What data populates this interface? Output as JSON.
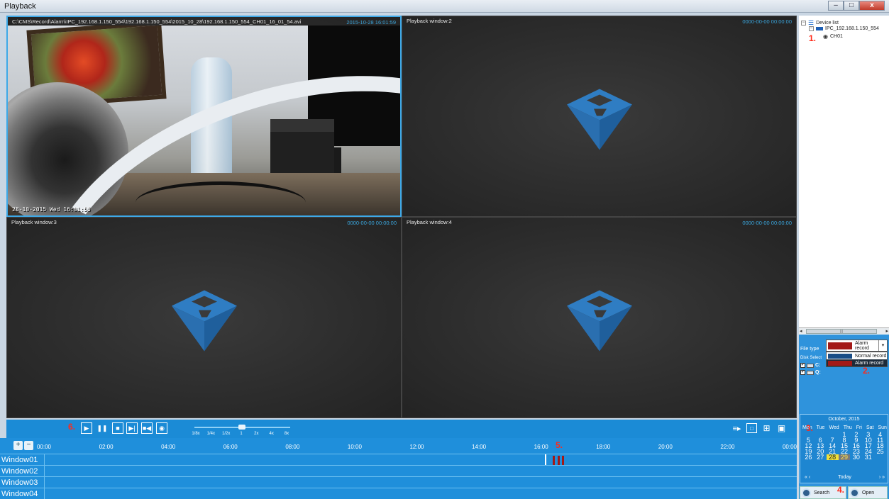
{
  "window": {
    "title": "Playback",
    "controls": [
      "–",
      "□",
      "x"
    ]
  },
  "panes": [
    {
      "label": "C:\\CMS\\Record\\Alarm\\IPC_192.168.1.150_554\\192.168.1.150_554\\2015_10_28\\192.168.1.150_554_CH01_16_01_54.avi",
      "time": "2015-10-28 16:01:59",
      "osd": "28-10-2015 Wed 16:01:55",
      "active": true
    },
    {
      "label": "Playback window:2",
      "time": "0000-00-00 00:00:00"
    },
    {
      "label": "Playback window:3",
      "time": "0000-00-00 00:00:00"
    },
    {
      "label": "Playback window:4",
      "time": "0000-00-00 00:00:00"
    }
  ],
  "controls": {
    "step_marker": "6.",
    "play_icon": "▶",
    "pause_icon": "❚❚",
    "stop_icon": "■",
    "step_icon": "▶|",
    "record_icon": "■◀",
    "snapshot_icon": "◉",
    "speeds": [
      "1/8x",
      "1/4x",
      "1/2x",
      "1",
      "2x",
      "4x",
      "8x"
    ],
    "speed_index": 3,
    "layout_icons": {
      "list": "≡▸",
      "single": "□",
      "quad": "⊞",
      "full": "▣"
    }
  },
  "timeline": {
    "hours": [
      "00:00",
      "02:00",
      "04:00",
      "06:00",
      "08:00",
      "10:00",
      "12:00",
      "14:00",
      "16:00",
      "18:00",
      "20:00",
      "22:00",
      "00:00"
    ],
    "step_marker": "5.",
    "rows": [
      "Window01",
      "Window02",
      "Window03",
      "Window04"
    ],
    "recordings": [
      {
        "row": 0,
        "hour": 16.35
      },
      {
        "row": 0,
        "hour": 16.5
      },
      {
        "row": 0,
        "hour": 16.65
      }
    ],
    "zoom_in": "+",
    "zoom_out": "−"
  },
  "device_tree": {
    "root": "Device list",
    "device": "IPC_192.168.1.150_554",
    "channel": "CH01",
    "step_marker": "1.",
    "scroll_mid": "|||"
  },
  "file_type": {
    "label": "File type",
    "selected": "Alarm record",
    "options": [
      "Normal record",
      "Alarm record"
    ],
    "step_marker": "2.",
    "colors": {
      "normal": "#1a4d86",
      "alarm": "#a31a18"
    }
  },
  "disks": {
    "header": "Disk  Select",
    "items": [
      "C:",
      "Q:"
    ]
  },
  "calendar": {
    "title": "October, 2015",
    "weekdays": [
      "Mon",
      "Tue",
      "Wed",
      "Thu",
      "Fri",
      "Sat",
      "Sun"
    ],
    "step_marker": "3.",
    "days": [
      "",
      "",
      "",
      "1",
      "2",
      "3",
      "4",
      "5",
      "6",
      "7",
      "8",
      "9",
      "10",
      "11",
      "12",
      "13",
      "14",
      "15",
      "16",
      "17",
      "18",
      "19",
      "20",
      "21",
      "22",
      "23",
      "24",
      "25",
      "26",
      "27",
      "28",
      "29",
      "30",
      "31"
    ],
    "today_label": "Today",
    "prev": "« ‹",
    "next": "› »"
  },
  "buttons": {
    "search": "Search",
    "open": "Open",
    "step_marker": "4."
  }
}
